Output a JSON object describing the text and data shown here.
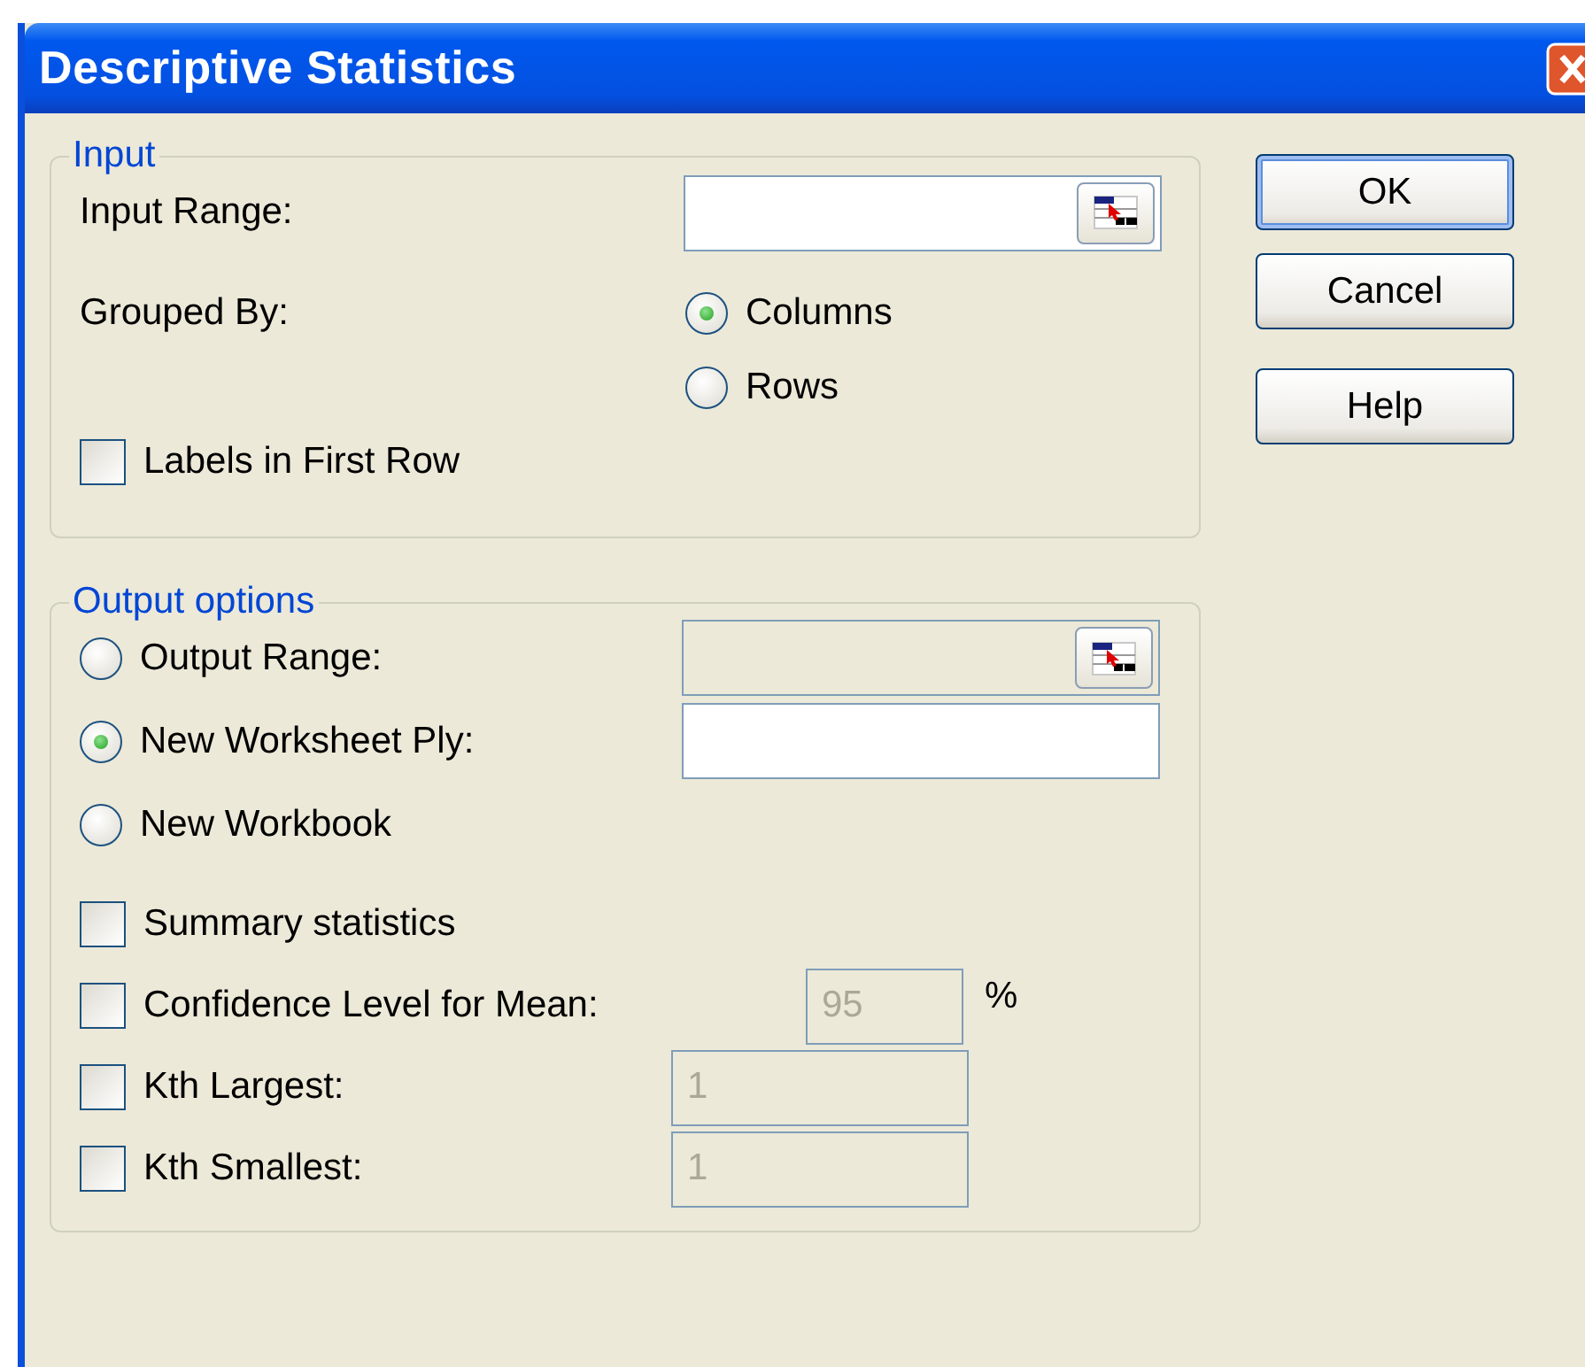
{
  "window": {
    "title": "Descriptive Statistics"
  },
  "input": {
    "legend": "Input",
    "input_range": {
      "label": "Input Range:",
      "field": {
        "kind": "range",
        "disabled": false
      }
    },
    "grouped_by": {
      "label": "Grouped By:",
      "options": [
        {
          "label": "Columns",
          "selected": true
        },
        {
          "label": "Rows",
          "selected": false
        }
      ]
    },
    "labels_in_first_row": {
      "label": "Labels in First Row",
      "checked": false
    }
  },
  "output": {
    "legend": "Output options",
    "destinations": [
      {
        "label": "Output Range:",
        "selected": false,
        "field": {
          "kind": "range",
          "disabled": true
        }
      },
      {
        "label": "New Worksheet Ply:",
        "selected": true,
        "field": {
          "kind": "text",
          "disabled": false
        }
      },
      {
        "label": "New Workbook",
        "selected": false
      }
    ],
    "statistics": [
      {
        "label": "Summary statistics",
        "checked": false
      },
      {
        "label": "Confidence Level for Mean:",
        "checked": false,
        "field": {
          "kind": "short",
          "value": "95",
          "disabled": true,
          "unit": "%"
        }
      },
      {
        "label": "Kth Largest:",
        "checked": false,
        "field": {
          "kind": "wide",
          "value": "1",
          "disabled": true
        }
      },
      {
        "label": "Kth Smallest:",
        "checked": false,
        "field": {
          "kind": "wide",
          "value": "1",
          "disabled": true
        }
      }
    ]
  },
  "buttons": [
    {
      "label": "OK",
      "default": true
    },
    {
      "label": "Cancel",
      "default": false
    },
    {
      "label": "Help",
      "default": false
    }
  ]
}
